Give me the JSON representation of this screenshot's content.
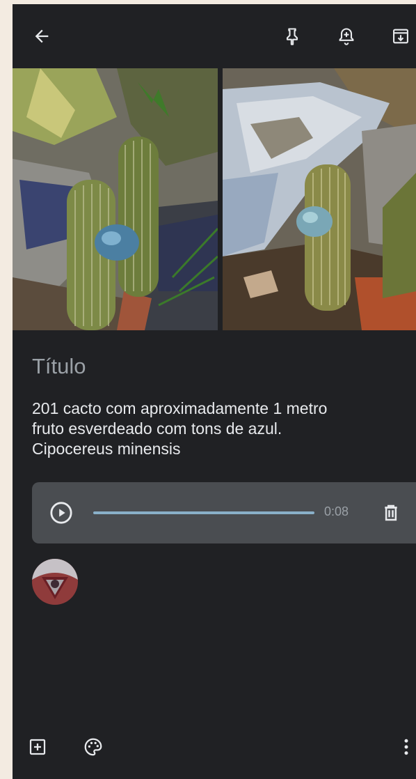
{
  "topbar": {
    "back_icon": "arrow-left-icon",
    "pin_icon": "pin-icon",
    "reminder_icon": "add-alert-icon",
    "archive_icon": "archive-icon"
  },
  "images": [
    {
      "name": "cactus-photo-1",
      "description": ""
    },
    {
      "name": "cactus-photo-2",
      "description": ""
    }
  ],
  "note": {
    "title_placeholder": "Título",
    "body_lines": [
      "201 cacto com aproximadamente 1 metro",
      "fruto esverdeado com tons de azul.",
      "Cipocereus minensis"
    ]
  },
  "audio": {
    "duration": "0:08",
    "play_icon": "play-circle-icon",
    "delete_icon": "trash-icon",
    "progress": 1.0
  },
  "collaborator": {
    "avatar_icon": "avatar"
  },
  "bottombar": {
    "add_icon": "add-box-icon",
    "palette_icon": "palette-icon",
    "more_icon": "more-vert-icon"
  },
  "colors": {
    "background": "#202124",
    "title": "#9aa0a6",
    "text": "#e8eaed",
    "audio_bg": "#4a4d51",
    "audio_track": "#8ab0c9"
  }
}
